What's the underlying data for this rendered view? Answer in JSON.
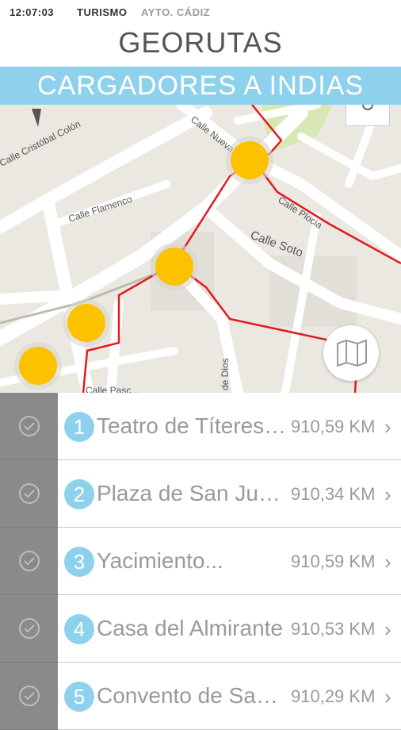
{
  "status": {
    "time": "12:07:03",
    "app": "TURISMO",
    "org": "AYTO. CÁDIZ"
  },
  "header": {
    "title": "GEORUTAS"
  },
  "route": {
    "name": "CARGADORES A INDIAS"
  },
  "map": {
    "streets": [
      "Calle Cristóbal Colón",
      "Calle Flamenco",
      "Calle Nueva",
      "Calle Plocia",
      "Calle Soto",
      "de Dios",
      "Calle Pasc..."
    ],
    "route_color": "#e01b22",
    "marker_color": "#fcc200",
    "map_button_icon": "map-icon",
    "location_button_icon": "my-location-icon"
  },
  "stops": [
    {
      "number": "1",
      "name": "Teatro de Títeres ...",
      "distance": "910,59 KM",
      "chevron": "›"
    },
    {
      "number": "2",
      "name": "Plaza de San Juan...",
      "distance": "910,34 KM",
      "chevron": "›"
    },
    {
      "number": "3",
      "name": "Yacimiento...",
      "distance": "910,59 KM",
      "chevron": "›"
    },
    {
      "number": "4",
      "name": "Casa del Almirante",
      "distance": "910,53 KM",
      "chevron": "›"
    },
    {
      "number": "5",
      "name": "Convento de Sant...",
      "distance": "910,29 KM",
      "chevron": "›"
    }
  ],
  "colors": {
    "accent": "#8dd1ec",
    "check_column": "#8a8a8a"
  }
}
